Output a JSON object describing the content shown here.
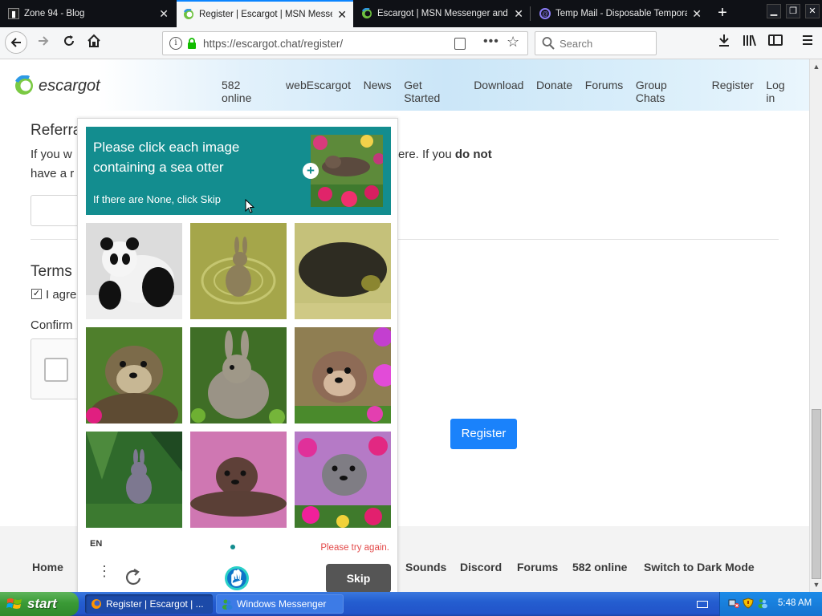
{
  "browser": {
    "tabs": [
      {
        "title": "Zone 94 - Blog",
        "icon": "zone94-favicon",
        "active": false
      },
      {
        "title": "Register | Escargot | MSN Messenger",
        "icon": "escargot-favicon",
        "active": true
      },
      {
        "title": "Escargot | MSN Messenger and Windows Live Messenger",
        "icon": "escargot-favicon",
        "active": false
      },
      {
        "title": "Temp Mail - Disposable Temporary Email",
        "icon": "tempmail-favicon",
        "active": false
      }
    ],
    "close_glyph": "✕",
    "new_tab_glyph": "+",
    "url": "https://escargot.chat/register/",
    "search_placeholder": "Search"
  },
  "site": {
    "brand": "escargot",
    "nav": [
      "582 online",
      "webEscargot",
      "News",
      "Get Started",
      "Download",
      "Donate",
      "Forums",
      "Group Chats",
      "Register",
      "Log in"
    ]
  },
  "form": {
    "referral_heading": "Referra",
    "referral_text_left_1": "If you w",
    "referral_text_left_2": "have a r",
    "referral_text_right_prefix": "ere. If you ",
    "referral_text_right_bold": "do not",
    "terms_heading": "Terms",
    "agree_label": "I agre",
    "agree_checked": true,
    "confirm_label": "Confirm",
    "register_button": "Register"
  },
  "footer": {
    "links": [
      "Home",
      "Sounds",
      "Discord",
      "Forums",
      "582 online",
      "Switch to Dark Mode"
    ]
  },
  "captcha": {
    "prompt": "Please click each image containing a sea otter",
    "hint": "If there are None, click Skip",
    "language": "EN",
    "error": "Please try again.",
    "skip_button": "Skip",
    "images": [
      {
        "subject": "panda",
        "has_target": false
      },
      {
        "subject": "rabbit in water",
        "has_target": false
      },
      {
        "subject": "blurry seal",
        "has_target": false
      },
      {
        "subject": "sea otter",
        "has_target": true
      },
      {
        "subject": "rabbit",
        "has_target": false
      },
      {
        "subject": "sea otter with flowers",
        "has_target": true
      },
      {
        "subject": "rabbit in grass",
        "has_target": false
      },
      {
        "subject": "seal on pink",
        "has_target": false
      },
      {
        "subject": "sea otter with flowers",
        "has_target": true
      }
    ],
    "accent_color": "#138d8f"
  },
  "taskbar": {
    "start_label": "start",
    "items": [
      {
        "label": "Register | Escargot | ...",
        "active": true
      },
      {
        "label": "Windows Messenger",
        "active": false
      }
    ],
    "clock": "5:48 AM"
  }
}
